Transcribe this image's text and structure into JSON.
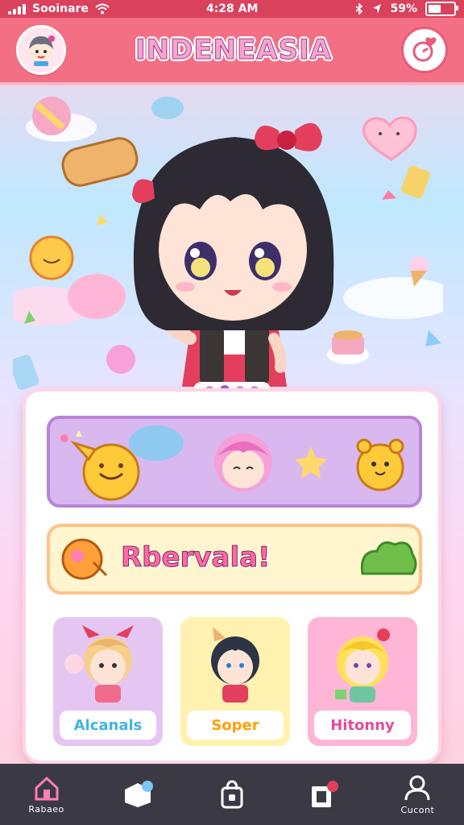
{
  "status": {
    "carrier": "Sooinare",
    "time": "4:28 AM",
    "battery": "59%",
    "battery_level": 0.59
  },
  "header": {
    "title": "INDENEASIA"
  },
  "hero": {
    "pager": {
      "count": 4,
      "active_index": 1
    }
  },
  "panel": {
    "reward_text": "Rbervala!",
    "cards": [
      {
        "label": "Alcanals",
        "bg": "#e5c6f2",
        "label_color": "#3fb4e6"
      },
      {
        "label": "Soper",
        "bg": "#fff2b0",
        "label_color": "#ffa000"
      },
      {
        "label": "Hitonny",
        "bg": "#ffb6d6",
        "label_color": "#e44a9c"
      }
    ]
  },
  "nav": {
    "items": [
      {
        "label": "Rabaeo",
        "icon": "home-icon"
      },
      {
        "label": "",
        "icon": "cube-icon"
      },
      {
        "label": "",
        "icon": "bag-icon"
      },
      {
        "label": "",
        "icon": "mail-icon"
      },
      {
        "label": "Cucont",
        "icon": "profile-icon"
      }
    ]
  },
  "colors": {
    "accent": "#f36f83",
    "statusbar": "#d9415d",
    "bottombar": "#3b3a44"
  }
}
